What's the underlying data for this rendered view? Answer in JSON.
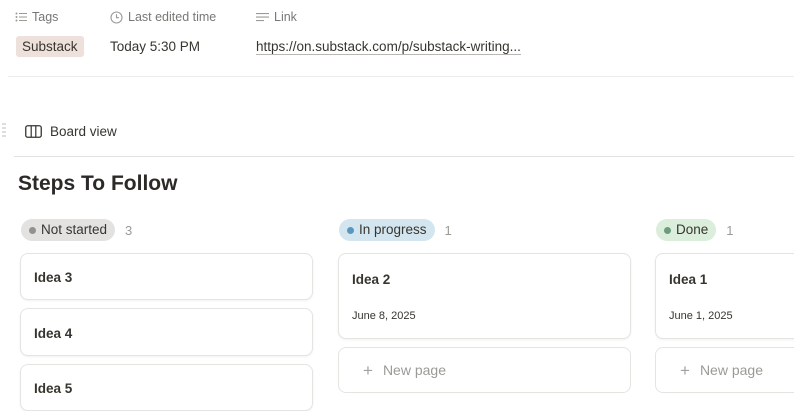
{
  "properties": {
    "tags": {
      "icon": "list-icon",
      "label": "Tags",
      "value": "Substack"
    },
    "last_edited": {
      "icon": "clock-icon",
      "label": "Last edited time",
      "value": "Today 5:30 PM"
    },
    "link": {
      "icon": "text-lines-icon",
      "label": "Link",
      "value": "https://on.substack.com/p/substack-writing..."
    }
  },
  "view": {
    "icon": "board-icon",
    "label": "Board view"
  },
  "board": {
    "title": "Steps To Follow",
    "columns": [
      {
        "status": "Not started",
        "count": "3",
        "pill_bg": "#e3e2e0",
        "dot_color": "#91918e",
        "cards": [
          {
            "title": "Idea 3"
          },
          {
            "title": "Idea 4"
          },
          {
            "title": "Idea 5"
          }
        ]
      },
      {
        "status": "In progress",
        "count": "1",
        "pill_bg": "#d3e5ef",
        "dot_color": "#5b97bd",
        "cards": [
          {
            "title": "Idea 2",
            "date": "June 8, 2025"
          }
        ],
        "new_page_label": "New page"
      },
      {
        "status": "Done",
        "count": "1",
        "pill_bg": "#dbeddb",
        "dot_color": "#6c9b7d",
        "cards": [
          {
            "title": "Idea 1",
            "date": "June 1, 2025"
          }
        ],
        "new_page_label": "New page"
      }
    ]
  }
}
